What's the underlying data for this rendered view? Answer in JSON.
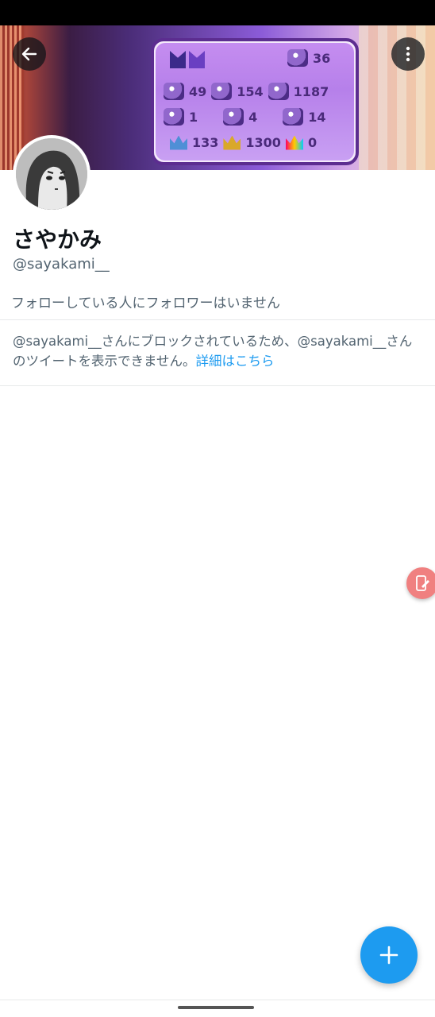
{
  "profile": {
    "display_name": "さやかみ",
    "handle": "@sayakami__",
    "follow_note": "フォローしている人にフォロワーはいません"
  },
  "blocked_notice": {
    "text": "@sayakami__さんにブロックされているため、@sayakami__さんのツイートを表示できません。",
    "link_label": "詳細はこちら"
  },
  "banner_stats": {
    "row1": [
      "36"
    ],
    "row2": [
      "49",
      "154",
      "1187"
    ],
    "row3": [
      "1",
      "4",
      "14"
    ],
    "row4": [
      "133",
      "1300",
      "0"
    ]
  },
  "icons": {
    "back": "back-arrow-icon",
    "more": "more-vertical-icon",
    "compose": "plus-icon",
    "floating": "phone-edit-icon"
  },
  "colors": {
    "accent": "#1d9bf0",
    "text_primary": "#0f1419",
    "text_secondary": "#536471",
    "divider": "#e7e9ea"
  }
}
